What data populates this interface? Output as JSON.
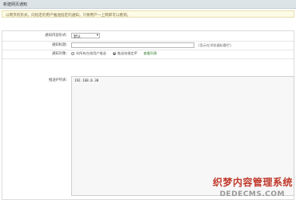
{
  "window": {
    "title": "新建网页通知"
  },
  "notice": {
    "text": "以网页的形式，向指定的用户推送指定的通知，只要用户一上网即可以看到。"
  },
  "form": {
    "type_label": "通知内容形式:",
    "type_value": "默认",
    "title_label": "通知标题:",
    "title_value": "",
    "title_hint": "(显示在浏览器标题栏)",
    "target_label": "通知对象:",
    "target_options": [
      "向所有在线用户推送",
      "推送给指定IP"
    ],
    "target_selected_index": 1,
    "target_link": "查看列表",
    "ip_label": "推送IP列表:",
    "ip_value": "192.168.0.30"
  },
  "watermark": {
    "line1": "织梦内容管理系统",
    "line2": "DEDECMS.COM"
  }
}
